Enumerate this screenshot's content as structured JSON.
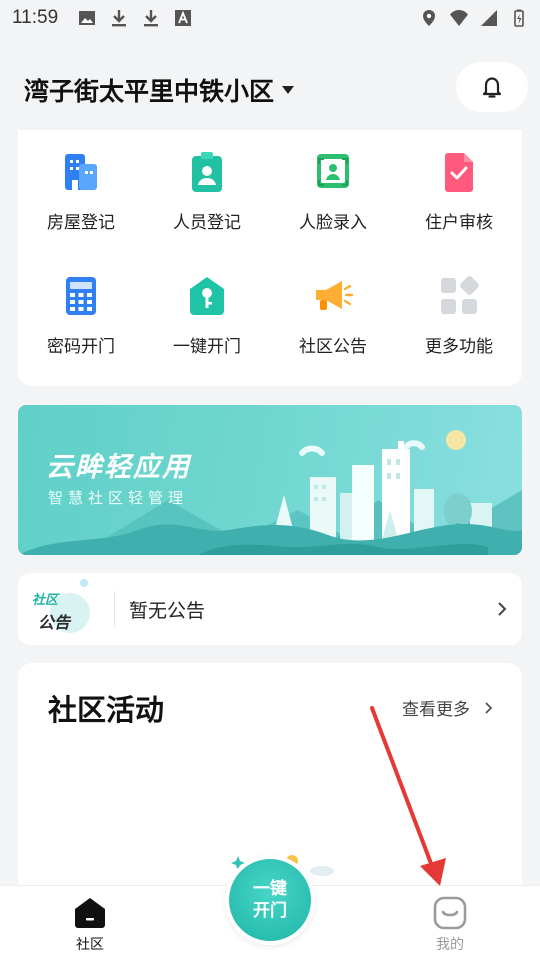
{
  "status_bar": {
    "time": "11:59"
  },
  "header": {
    "community": "湾子街太平里中铁小区"
  },
  "functions": [
    {
      "label": "房屋登记",
      "icon": "building-icon"
    },
    {
      "label": "人员登记",
      "icon": "person-badge-icon"
    },
    {
      "label": "人脸录入",
      "icon": "face-scan-icon"
    },
    {
      "label": "住户审核",
      "icon": "check-document-icon"
    },
    {
      "label": "密码开门",
      "icon": "keypad-icon"
    },
    {
      "label": "一键开门",
      "icon": "key-house-icon"
    },
    {
      "label": "社区公告",
      "icon": "megaphone-icon"
    },
    {
      "label": "更多功能",
      "icon": "grid-more-icon"
    }
  ],
  "banner": {
    "title": "云眸轻应用",
    "subtitle": "智慧社区轻管理"
  },
  "notice": {
    "badge_line1": "社区",
    "badge_line2": "公告",
    "text": "暂无公告"
  },
  "activity": {
    "title": "社区活动",
    "see_more": "查看更多"
  },
  "bottom_nav": {
    "community": "社区",
    "center_line1": "一键",
    "center_line2": "开门",
    "mine": "我的"
  },
  "colors": {
    "accent": "#2ec4b6",
    "active": "#111111",
    "inactive": "#9a9a9a",
    "annotation": "#e53935"
  }
}
